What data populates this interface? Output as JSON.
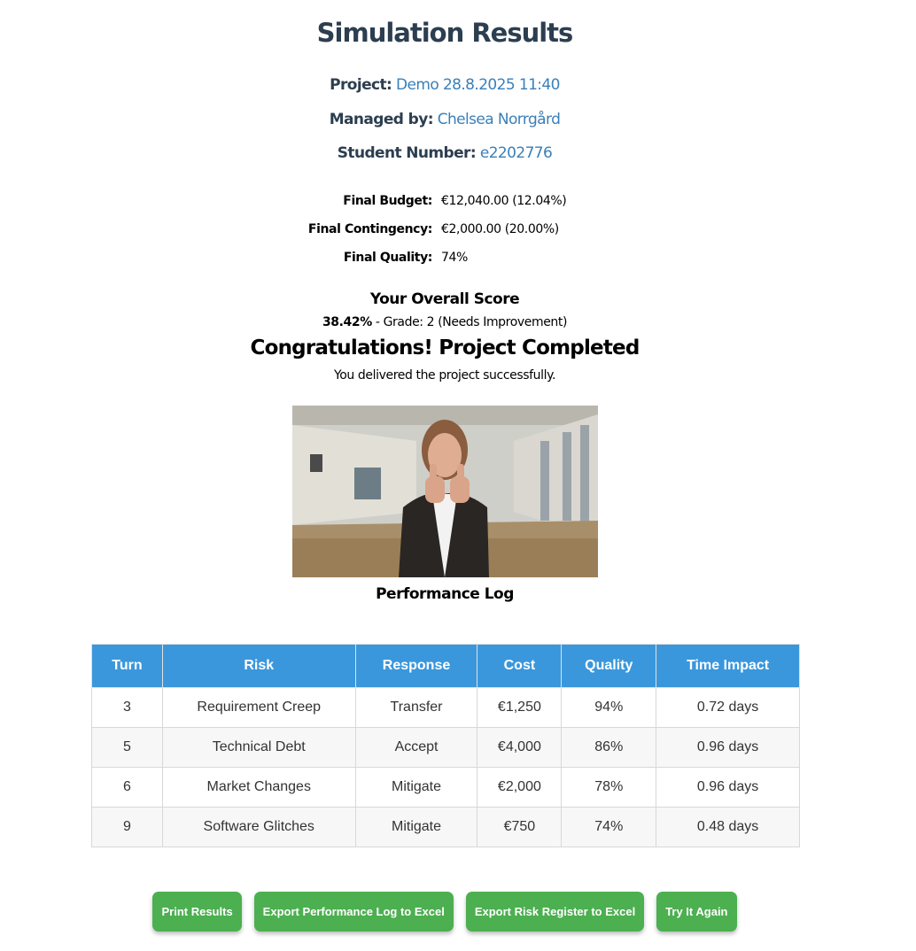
{
  "page": {
    "title": "Simulation Results"
  },
  "project": {
    "project_label": "Project:",
    "project_value": "Demo 28.8.2025 11:40",
    "manager_label": "Managed by:",
    "manager_value": "Chelsea Norrgård",
    "student_label": "Student Number:",
    "student_value": "e2202776"
  },
  "finals": [
    {
      "label": "Final Budget:",
      "value": "€12,040.00 (12.04%)"
    },
    {
      "label": "Final Contingency:",
      "value": "€2,000.00 (20.00%)"
    },
    {
      "label": "Final Quality:",
      "value": "74%"
    }
  ],
  "score": {
    "heading": "Your Overall Score",
    "percent": "38.42%",
    "grade_text": " - Grade: 2 (Needs Improvement)"
  },
  "result": {
    "heading": "Congratulations! Project Completed",
    "message": "You delivered the project successfully."
  },
  "log": {
    "heading": "Performance Log",
    "columns": [
      "Turn",
      "Risk",
      "Response",
      "Cost",
      "Quality",
      "Time Impact"
    ],
    "rows": [
      [
        "3",
        "Requirement Creep",
        "Transfer",
        "€1,250",
        "94%",
        "0.72 days"
      ],
      [
        "5",
        "Technical Debt",
        "Accept",
        "€4,000",
        "86%",
        "0.96 days"
      ],
      [
        "6",
        "Market Changes",
        "Mitigate",
        "€2,000",
        "78%",
        "0.96 days"
      ],
      [
        "9",
        "Software Glitches",
        "Mitigate",
        "€750",
        "74%",
        "0.48 days"
      ]
    ]
  },
  "buttons": {
    "print": "Print Results",
    "export_log": "Export Performance Log to Excel",
    "export_risk": "Export Risk Register to Excel",
    "retry": "Try It Again"
  },
  "colors": {
    "title": "#2c3e50",
    "link_value": "#3a7fb8",
    "table_header": "#3a97dc",
    "button": "#4caf50"
  }
}
